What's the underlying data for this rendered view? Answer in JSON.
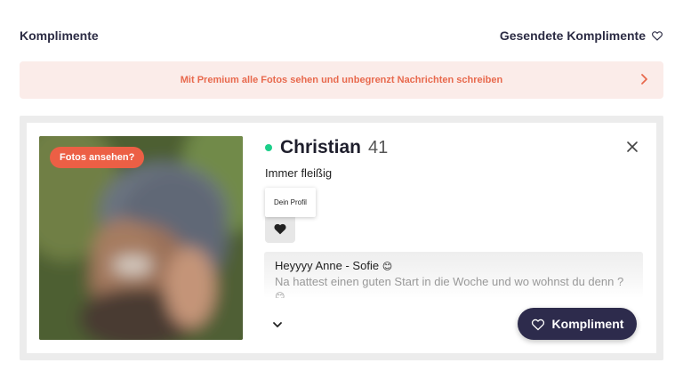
{
  "header": {
    "title": "Komplimente",
    "sent_label": "Gesendete Komplimente",
    "sent_icon": "heart-outline-icon"
  },
  "promo": {
    "text": "Mit Premium alle Fotos sehen und unbegrenzt Nachrichten schreiben",
    "icon": "chevron-right-icon",
    "color": "#e8694d"
  },
  "profile": {
    "photo_badge": "Fotos ansehen?",
    "name": "Christian",
    "age": "41",
    "online_color": "#1ccf8a",
    "tagline": "Immer fleißig"
  },
  "tooltip": {
    "text": "Dein Profil"
  },
  "message": {
    "line1": "Heyyyy Anne - Sofie",
    "line1_emoji": "😊",
    "line2": "Na hattest einen guten Start in die Woche und wo wohnst du denn ?",
    "line2_emoji": "😊"
  },
  "actions": {
    "kompliment_label": "Kompliment",
    "accent": "#2d2b4c"
  }
}
